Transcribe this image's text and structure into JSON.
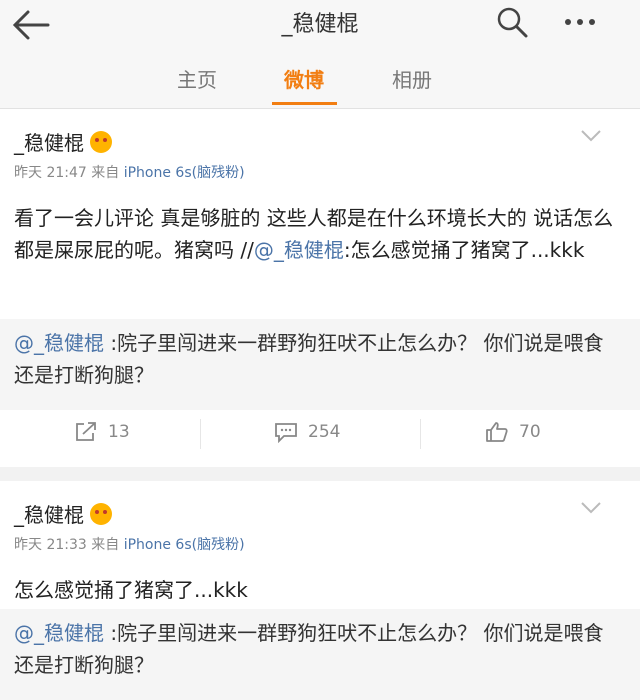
{
  "header": {
    "title": "_稳健棍"
  },
  "tabs": [
    {
      "label": "主页"
    },
    {
      "label": "微博"
    },
    {
      "label": "相册"
    }
  ],
  "posts": [
    {
      "username": "_稳健棍",
      "time": "昨天 21:47",
      "source_prefix": "来自",
      "device": "iPhone 6s(脑残粉)",
      "text": "看了一会儿评论 真是够脏的 这些人都是在什么环境长大的 说话怎么都是屎尿屁的呢。猪窝吗 //",
      "mention": "@_稳健棍",
      "text_after": ":怎么感觉捅了猪窝了...kkk",
      "repost_mention": "@_稳健棍",
      "repost_text": " :院子里闯进来一群野狗狂吠不止怎么办？ 你们说是喂食还是打断狗腿？",
      "share_count": "13",
      "comment_count": "254",
      "like_count": "70"
    },
    {
      "username": "_稳健棍",
      "time": "昨天 21:33",
      "source_prefix": "来自",
      "device": "iPhone 6s(脑残粉)",
      "text": "怎么感觉捅了猪窝了...kkk",
      "repost_mention": "@_稳健棍",
      "repost_text": " :院子里闯进来一群野狗狂吠不止怎么办？ 你们说是喂食还是打断狗腿？"
    }
  ],
  "colors": {
    "accent": "#f27e12",
    "link": "#4b74a8"
  },
  "icons": [
    "back-arrow-icon",
    "search-icon",
    "more-icon",
    "chevron-down-icon",
    "vip-badge-icon",
    "share-icon",
    "comment-icon",
    "like-icon"
  ]
}
